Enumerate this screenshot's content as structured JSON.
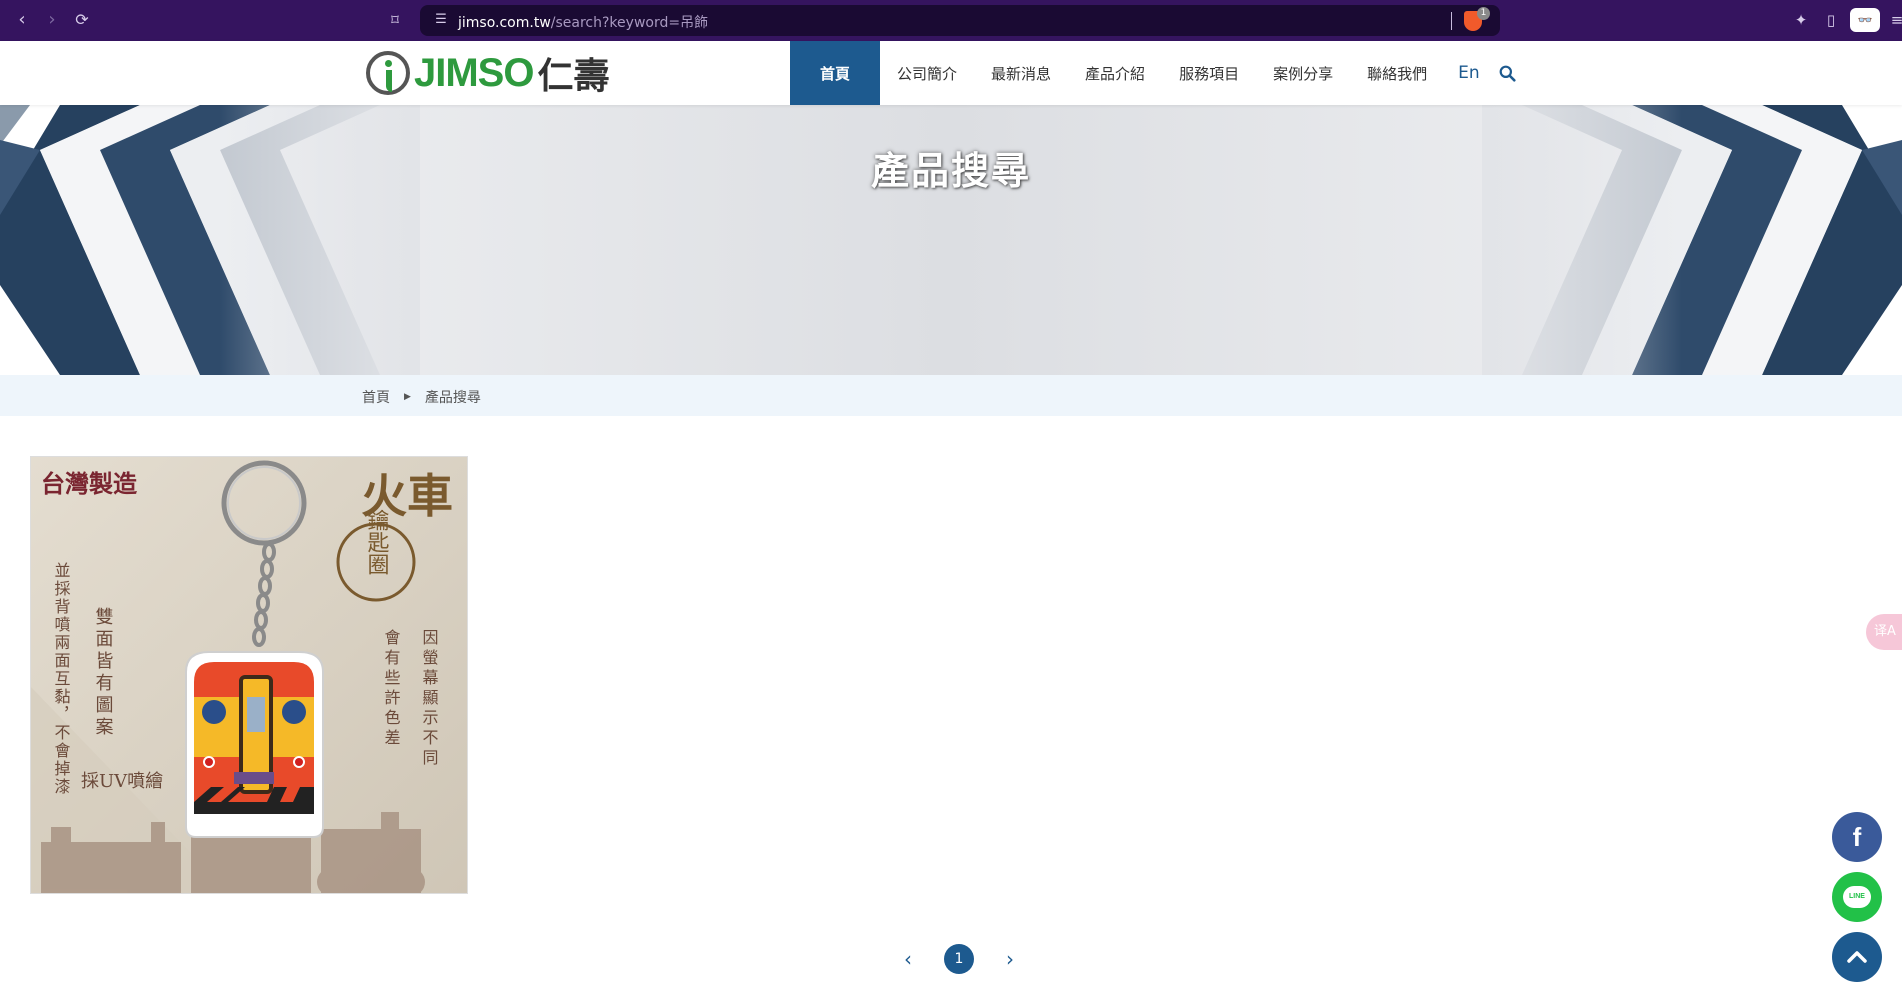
{
  "browser": {
    "url_host": "jimso.com.tw",
    "url_path": "/search?keyword=吊飾",
    "brave_count": "1",
    "back_icon": "chevron-left-icon",
    "forward_icon": "chevron-right-icon",
    "reload_icon": "reload-icon"
  },
  "header": {
    "logo_text": "JIMSO",
    "logo_cjk": "仁壽",
    "nav": [
      {
        "label": "首頁"
      },
      {
        "label": "公司簡介"
      },
      {
        "label": "最新消息"
      },
      {
        "label": "產品介紹"
      },
      {
        "label": "服務項目"
      },
      {
        "label": "案例分享"
      },
      {
        "label": "聯絡我們"
      }
    ],
    "lang": "En"
  },
  "banner": {
    "title": "產品搜尋"
  },
  "breadcrumb": {
    "home": "首頁",
    "current": "產品搜尋"
  },
  "product": {
    "texts": {
      "made_in": "台灣製造",
      "title_big": "火車",
      "title_small": "鑰匙圈",
      "left_col1": "並採背噴兩面互黏，不會掉漆",
      "left_col2": "雙面皆有圖案",
      "uv": "採UV噴繪",
      "right_col1": "因螢幕顯示不同",
      "right_col2": "會有些許色差"
    }
  },
  "pagination": {
    "current": "1"
  },
  "colors": {
    "brand_blue": "#1d5a8f",
    "logo_green": "#2e9a3e",
    "facebook": "#3a5a9a",
    "line": "#22c148"
  },
  "floating": {
    "fb": "f",
    "line": "LINE",
    "translate": "译A"
  }
}
